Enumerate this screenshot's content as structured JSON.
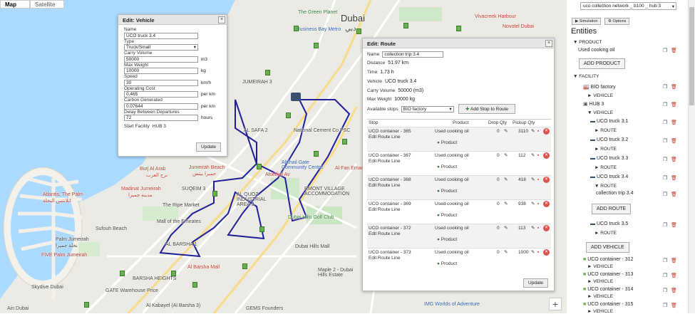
{
  "map": {
    "tab_map": "Map",
    "tab_satellite": "Satellite",
    "labels": {
      "city": "Dubai",
      "city_ar": "دبي",
      "green_planet": "The Green Planet",
      "business_bay": "Business Bay Metro",
      "vivacreek": "Vivacreek Harbour",
      "novotel": "Novotel Dubai",
      "jumeirah3": "JUMEIRAH 3",
      "alsafa2": "AL SAFA 2",
      "national_cement": "National Cement Co PSC",
      "jumeirah_beach": "Jumeirah Beach",
      "jumeirah_beach_ar": "جميرا بيتش",
      "burj_al_arab": "Burj Al Arab",
      "burj_al_arab_ar": "برج العرب",
      "madinat": "Madinat Jumeirah",
      "madinat_ar": "مدينة جميرا",
      "suqeim3": "SUQEIM 3",
      "ripe_market": "The Ripe Market",
      "barsha_heights": "BARSHA HEIGHTS",
      "mall_emirates": "Mall of the Emirates",
      "albarsha1": "AL BARSHA 1",
      "albarsha_mall": "Al Barsha Mall",
      "alquoz": "AL QUOZ INDUSTRIAL AREA 3",
      "alfan": "Al Fan Emarat",
      "alkhail": "AlKhail Gate Community Centre",
      "alserkal": "Alserkal Av",
      "dubai_hills_mall": "Dubai Hills Mall",
      "dubai_hills_golf": "Dubai Hills Golf Club",
      "atlantis": "Atlantis, The Palm",
      "atlantis_ar": "اتلانتس النخلة",
      "five_palm": "FIVE Palm Jumeirah",
      "palm_jumeirah": "Palm Jumeirah",
      "palm_jumeirah_ar": "نخلة جميرا",
      "sufouh": "Sufouh Beach",
      "gate_warehouse": "GATE Warehouse Price",
      "skydive": "Skydive Dubai",
      "maple2": "Maple 2 - Dubai Hills Estate",
      "img_worlds": "IMG Worlds of Adventure",
      "gems": "GEMS Founders",
      "al_kabayel": "Al Kabayel (Al Barsha 3)",
      "pier": "Ain Dubai",
      "samaya": "Samaya",
      "rmont": "RMONT VILLAGE ACCOMMODATION",
      "mohammed": "Mohammed Bin Rashid"
    },
    "zoom_in": "+"
  },
  "vehicle_dialog": {
    "title": "Edit: Vehicle",
    "close": "×",
    "name_label": "Name",
    "name_value": "UCO truck 3.4",
    "type_label": "Type",
    "type_value": "Truck/Small",
    "capacity_label": "Carry Volume",
    "capacity_value": "50000",
    "capacity_unit": "m3",
    "max_weight_label": "Max Weight",
    "max_weight_value": "10000",
    "max_weight_unit": "kg",
    "speed_label": "Speed",
    "speed_value": "30",
    "speed_unit": "km/h",
    "op_cost_label": "Operating Cost",
    "op_cost_value": "0.465",
    "op_cost_unit": "per km",
    "carbon_label": "Carbon Generated",
    "carbon_value": "0.07644",
    "carbon_unit": "per km",
    "delay_label": "Delay Between Departures",
    "delay_value": "72",
    "delay_unit": "hours",
    "start_label": "Start Facility",
    "start_value": "HUB 3",
    "update": "Update"
  },
  "route_dialog": {
    "title": "Edit: Route",
    "close": "×",
    "name_label": "Name",
    "name_value": "collection trip 3.4",
    "distance_label": "Distance",
    "distance_value": "51.97 km",
    "time_label": "Time",
    "time_value": "1.73 h",
    "vehicle_label": "Vehicle",
    "vehicle_value": "UCO truck 3.4",
    "carry_label": "Carry Volume",
    "carry_value": "50000 (m3)",
    "maxw_label": "Max Weight",
    "maxw_value": "10000 kg",
    "stops_label": "Available stops",
    "stops_value": "BIO factory",
    "add_stop": "Add Stop to Route",
    "col_stop": "Stop",
    "col_product": "Product",
    "col_drop": "Drop Qty",
    "col_pickup": "Pickup Qty",
    "edit_line": "Edit Route Line",
    "product_name": "Used cooking oil",
    "product_tag": "Product",
    "stops": [
      {
        "name": "UCO container - 365",
        "drop": "0",
        "pickup": "3110"
      },
      {
        "name": "UCO container - 367",
        "drop": "0",
        "pickup": "112"
      },
      {
        "name": "UCO container - 368",
        "drop": "0",
        "pickup": "418"
      },
      {
        "name": "UCO container - 369",
        "drop": "0",
        "pickup": "938"
      },
      {
        "name": "UCO container - 372",
        "drop": "0",
        "pickup": "113"
      },
      {
        "name": "UCO container - 373",
        "drop": "0",
        "pickup": "1000"
      }
    ],
    "update": "Update"
  },
  "panel": {
    "network_select": "uco collection network _ b100 _ hub 3",
    "simulation": "Simulation",
    "options": "Options",
    "entities_title": "Entities",
    "product_header": "PRODUCT",
    "product_item": "Used cooking oil",
    "add_product": "ADD PRODUCT",
    "facility_header": "FACILITY",
    "bio_factory": "BIO factory",
    "vehicle": "VEHICLE",
    "hub3": "HUB 3",
    "route": "ROUTE",
    "trucks": [
      "UCO truck 3.1",
      "UCO truck 3.2",
      "UCO truck 3.3",
      "UCO truck 3.4",
      "UCO truck 3.5"
    ],
    "collection_trip": "collection trip 3.4",
    "add_route": "ADD ROUTE",
    "add_vehicle": "ADD VEHICLE",
    "containers": [
      "UCO container - 312",
      "UCO container - 313",
      "UCO container - 314",
      "UCO container - 315"
    ]
  }
}
